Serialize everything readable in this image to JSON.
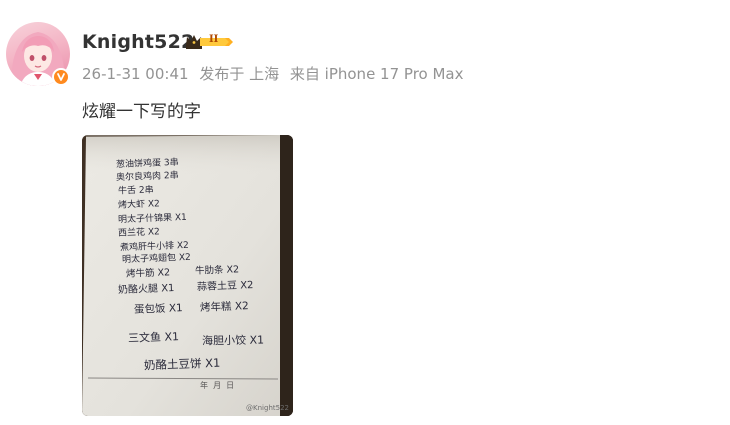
{
  "user": {
    "name": "Knight522",
    "level_badge": "II"
  },
  "meta": {
    "timestamp": "26-1-31 00:41",
    "posted_in_label": "发布于 上海",
    "source_label": "来自 iPhone 17 Pro Max"
  },
  "post": {
    "text": "炫耀一下写的字",
    "image_watermark": "@Knight522"
  },
  "photo_lines": [
    "葱油饼鸡蛋 3串",
    "奥尔良鸡肉 2串",
    "牛舌 2串",
    "烤大虾 X2",
    "明太子什锦果 X1",
    "西兰花 X2",
    "煮鸡肝牛小排 X2",
    "明太子鸡翅包 X2",
    "烤牛筋 X2",
    "牛肋条 X2",
    "奶酪火腿 X1",
    "蒜蓉土豆 X2",
    "蛋包饭 X1",
    "烤年糕 X2",
    "三文鱼 X1",
    "海胆小饺 X1",
    "奶酪土豆饼 X1",
    "年  月  日"
  ],
  "colors": {
    "accent_orange": "#ff8a1f",
    "text_dark": "#333333",
    "text_meta": "#939393"
  }
}
